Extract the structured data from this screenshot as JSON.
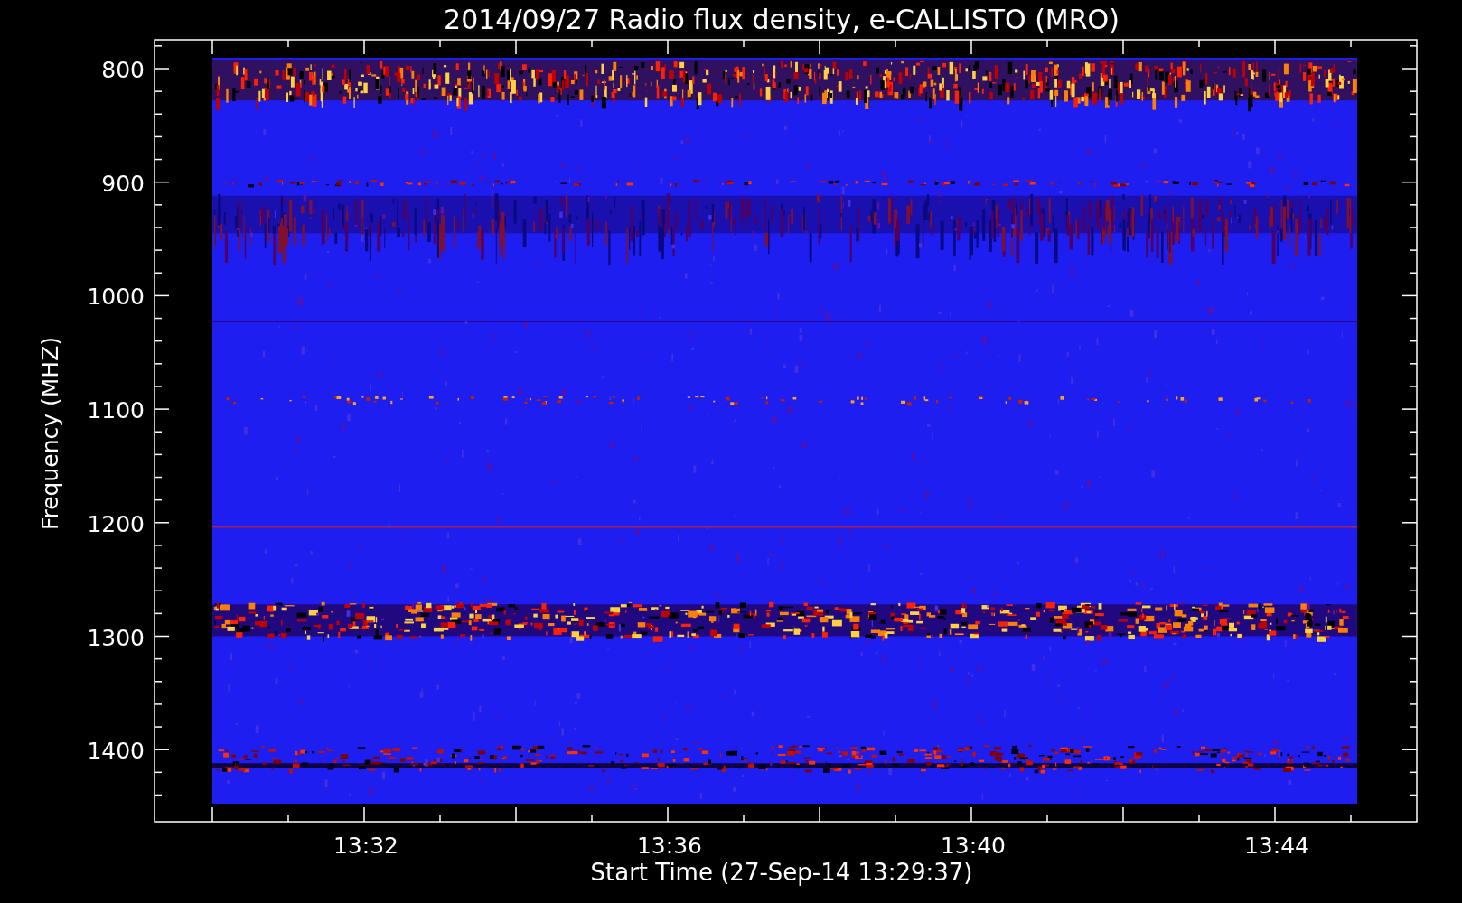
{
  "title": "2014/09/27  Radio flux density, e-CALLISTO (MRO)",
  "plot": {
    "ylabel": "Frequency (MHZ)",
    "xlabel": "Start Time (27-Sep-14 13:29:37)",
    "yticks": [
      "800",
      "900",
      "1000",
      "1100",
      "1200",
      "1300",
      "1400"
    ],
    "xticks": [
      "13:32",
      "13:36",
      "13:40",
      "13:44"
    ]
  }
}
